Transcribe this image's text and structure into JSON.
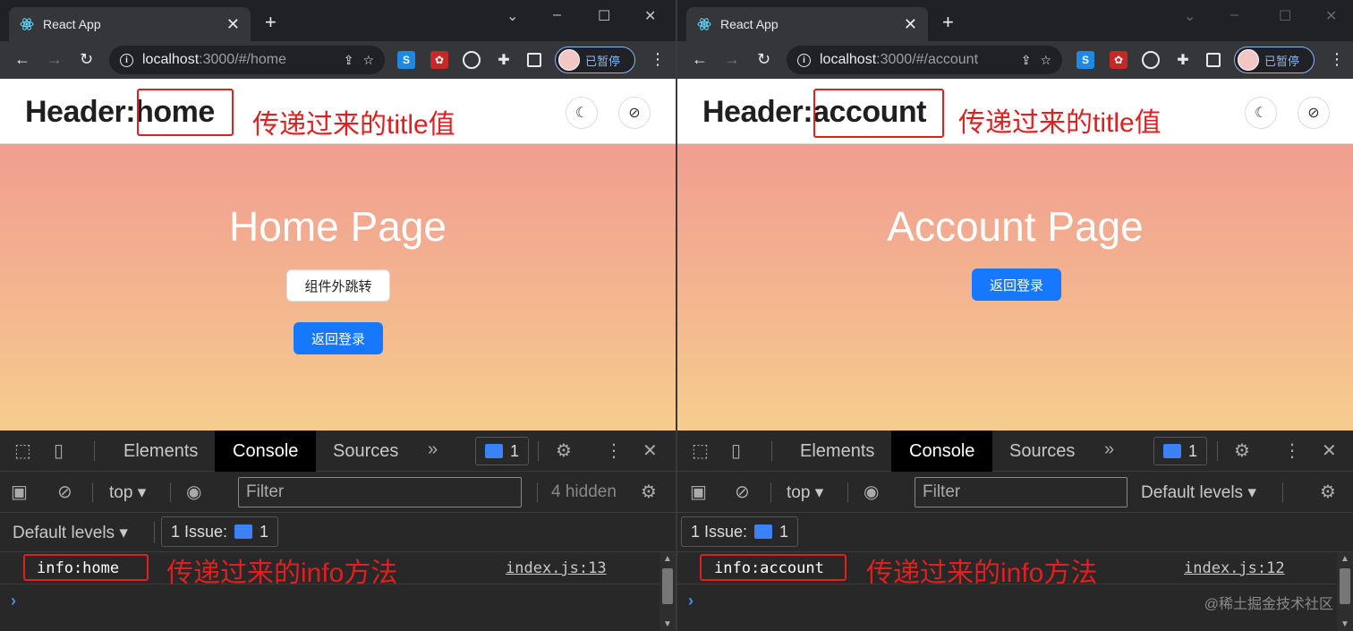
{
  "left": {
    "tab_title": "React App",
    "url_host": "localhost",
    "url_path": ":3000/#/home",
    "profile_label": "已暂停",
    "header_prefix": "Header:",
    "header_value": "home",
    "header_annotation": "传递过来的title值",
    "page_title": "Home Page",
    "button_outside_jump": "组件外跳转",
    "button_back_login": "返回登录",
    "devtools": {
      "tab_elements": "Elements",
      "tab_console": "Console",
      "tab_sources": "Sources",
      "more_tabs": "»",
      "message_count": "1",
      "context": "top",
      "filter_placeholder": "Filter",
      "hidden_count": "4 hidden",
      "default_levels": "Default levels",
      "issues_label": "1 Issue:",
      "issues_count": "1",
      "log_text": "info:home",
      "log_annotation": "传递过来的info方法",
      "log_source": "index.js:13"
    }
  },
  "right": {
    "tab_title": "React App",
    "url_host": "localhost",
    "url_path": ":3000/#/account",
    "profile_label": "已暂停",
    "header_prefix": "Header:",
    "header_value": "account",
    "header_annotation": "传递过来的title值",
    "page_title": "Account Page",
    "button_back_login": "返回登录",
    "devtools": {
      "tab_elements": "Elements",
      "tab_console": "Console",
      "tab_sources": "Sources",
      "more_tabs": "»",
      "message_count": "1",
      "context": "top",
      "filter_placeholder": "Filter",
      "default_levels": "Default levels",
      "issues_label": "1 Issue:",
      "issues_count": "1",
      "log_text": "info:account",
      "log_annotation": "传递过来的info方法",
      "log_source": "index.js:12"
    }
  },
  "watermark": "@稀土掘金技术社区",
  "colors": {
    "annotation_red": "#e02020",
    "primary_blue": "#1677ff",
    "gradient_top": "#f09491",
    "gradient_bottom": "#f6cd8e"
  }
}
